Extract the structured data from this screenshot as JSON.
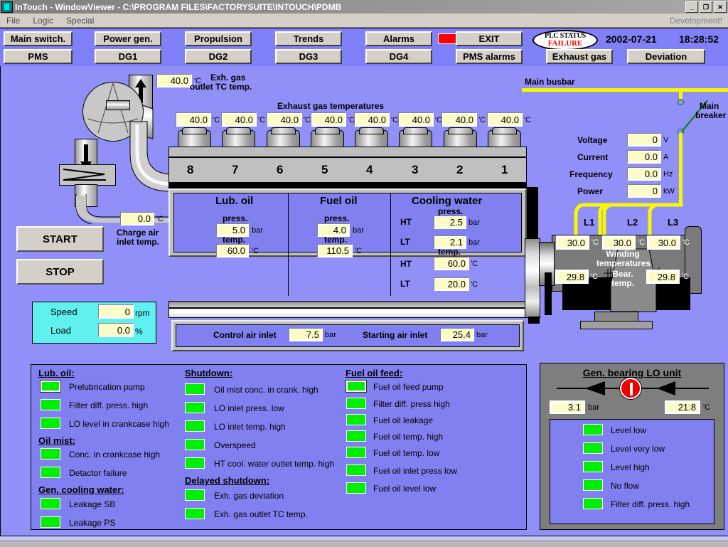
{
  "window": {
    "title": "InTouch - WindowViewer - C:\\PROGRAM FILES\\FACTORYSUITE\\INTOUCH\\PDMB",
    "icon": "intouch-icon",
    "minimize": "_",
    "restore": "❐",
    "close": "✕",
    "development_note": "Development!"
  },
  "menu": {
    "items": [
      "File",
      "Logic",
      "Special"
    ]
  },
  "toolbar": {
    "row1": [
      {
        "label": "Main switch."
      },
      {
        "label": "Power gen."
      },
      {
        "label": "Propulsion"
      },
      {
        "label": "Trends"
      },
      {
        "label": "Alarms"
      },
      {
        "label": "EXIT"
      }
    ],
    "row2": [
      {
        "label": "PMS"
      },
      {
        "label": "DG1"
      },
      {
        "label": "DG2"
      },
      {
        "label": "DG3"
      },
      {
        "label": "DG4"
      },
      {
        "label": "PMS alarms"
      },
      {
        "label": "Exhaust gas"
      },
      {
        "label": "Deviation"
      }
    ],
    "alarm_lamp_color": "#ff0000",
    "plc_status": {
      "line1": "PLC STATUS",
      "line2": "FAILURE",
      "color": "#ff0000"
    },
    "date": "2002-07-21",
    "time": "18:28:52"
  },
  "engine": {
    "tc_outlet": {
      "value": "40.0",
      "unit": "'C",
      "label_line1": "Exh. gas",
      "label_line2": "outlet TC temp."
    },
    "exhaust_title": "Exhaust gas temperatures",
    "exhaust_unit": "'C",
    "cylinders": [
      {
        "number": "8",
        "temp": "40.0"
      },
      {
        "number": "7",
        "temp": "40.0"
      },
      {
        "number": "6",
        "temp": "40.0"
      },
      {
        "number": "5",
        "temp": "40.0"
      },
      {
        "number": "4",
        "temp": "40.0"
      },
      {
        "number": "3",
        "temp": "40.0"
      },
      {
        "number": "2",
        "temp": "40.0"
      },
      {
        "number": "1",
        "temp": "40.0"
      }
    ],
    "charge_air": {
      "value": "0.0",
      "unit": "'C",
      "label_line1": "Charge air",
      "label_line2": "inlet temp."
    }
  },
  "controls": {
    "start": "START",
    "stop": "STOP",
    "speed_label": "Speed",
    "speed_value": "0",
    "speed_unit": "rpm",
    "load_label": "Load",
    "load_value": "0.0",
    "load_unit": "%"
  },
  "media": {
    "lub_oil": {
      "title": "Lub. oil",
      "press_label": "press.",
      "press_value": "5.0",
      "press_unit": "bar",
      "temp_label": "temp.",
      "temp_value": "60.0",
      "temp_unit": "'C"
    },
    "fuel_oil": {
      "title": "Fuel oil",
      "press_label": "press.",
      "press_value": "4.0",
      "press_unit": "bar",
      "temp_label": "temp.",
      "temp_value": "110.5",
      "temp_unit": "'C"
    },
    "cooling_water": {
      "title": "Cooling water",
      "press_label": "press.",
      "press_ht_label": "HT",
      "press_ht_value": "2.5",
      "press_ht_unit": "bar",
      "press_lt_label": "LT",
      "press_lt_value": "2.1",
      "press_lt_unit": "bar",
      "temp_label": "temp.",
      "temp_ht_label": "HT",
      "temp_ht_value": "60.0",
      "temp_ht_unit": "'C",
      "temp_lt_label": "LT",
      "temp_lt_value": "20.0",
      "temp_lt_unit": "'C"
    },
    "air": {
      "control_label": "Control air inlet",
      "control_value": "7.5",
      "control_unit": "bar",
      "starting_label": "Starting air inlet",
      "starting_value": "25.4",
      "starting_unit": "bar"
    }
  },
  "electrical": {
    "busbar_label": "Main busbar",
    "breaker_label_line1": "Main",
    "breaker_label_line2": "breaker",
    "measurements": [
      {
        "label": "Voltage",
        "value": "0",
        "unit": "V"
      },
      {
        "label": "Current",
        "value": "0.0",
        "unit": "A"
      },
      {
        "label": "Frequency",
        "value": "0.0",
        "unit": "Hz"
      },
      {
        "label": "Power",
        "value": "0",
        "unit": "kW"
      }
    ],
    "phases": [
      "L1",
      "L2",
      "L3"
    ],
    "winding_label_line1": "Winding",
    "winding_label_line2": "temperatures",
    "winding_temps": [
      "30.0",
      "30.0",
      "30.0"
    ],
    "winding_unit": "'C",
    "bearing_label_line1": "Bear.",
    "bearing_label_line2": "temp.",
    "bearing_temps": [
      "29.8",
      "29.8"
    ],
    "bearing_unit": "'C"
  },
  "alarms": {
    "col1": {
      "groups": [
        {
          "header": "Lub. oil:",
          "items": [
            {
              "label": "Prelubrication pump",
              "color": "#00ee00",
              "framed": true
            },
            {
              "label": "Filter diff. press. high",
              "color": "#00ee00",
              "framed": false
            },
            {
              "label": "LO level in crankcase high",
              "color": "#00ee00",
              "framed": false
            }
          ]
        },
        {
          "header": "Oil mist:",
          "items": [
            {
              "label": "Conc. in crankcase high",
              "color": "#00ee00",
              "framed": false
            },
            {
              "label": "Detactor failure",
              "color": "#00ee00",
              "framed": false
            }
          ]
        },
        {
          "header": "Gen. cooling water:",
          "items": [
            {
              "label": "Leakage SB",
              "color": "#00ee00",
              "framed": false
            },
            {
              "label": "Leakage PS",
              "color": "#00ee00",
              "framed": false
            }
          ]
        }
      ]
    },
    "col2": {
      "groups": [
        {
          "header": "Shutdown:",
          "items": [
            {
              "label": "Oil mist conc. in crank. high",
              "color": "#00ee00",
              "framed": false
            },
            {
              "label": "LO inlet press. low",
              "color": "#00ee00",
              "framed": false
            },
            {
              "label": "LO inlet temp. high",
              "color": "#00ee00",
              "framed": false
            },
            {
              "label": "Overspeed",
              "color": "#00ee00",
              "framed": false
            },
            {
              "label": "HT cool. water outlet temp. high",
              "color": "#00ee00",
              "framed": false
            }
          ]
        },
        {
          "header": "Delayed shutdown:",
          "items": [
            {
              "label": "Exh. gas deviation",
              "color": "#00ee00",
              "framed": false
            },
            {
              "label": "Exh. gas outlet TC temp.",
              "color": "#00ee00",
              "framed": false
            }
          ]
        }
      ]
    },
    "col3": {
      "groups": [
        {
          "header": "Fuel oil feed:",
          "items": [
            {
              "label": "Fuel oil feed pump",
              "color": "#00ee00",
              "framed": true
            },
            {
              "label": "Filter diff. press high",
              "color": "#00ee00",
              "framed": false
            },
            {
              "label": "Fuel oil leakage",
              "color": "#00ee00",
              "framed": false
            },
            {
              "label": "Fuel oil temp. high",
              "color": "#00ee00",
              "framed": false
            },
            {
              "label": "Fuel oil temp. low",
              "color": "#00ee00",
              "framed": false
            },
            {
              "label": "Fuel oil inlet press low",
              "color": "#00ee00",
              "framed": false
            },
            {
              "label": "Fuel oil level low",
              "color": "#00ee00",
              "framed": false
            }
          ]
        }
      ]
    }
  },
  "lo_unit": {
    "title": "Gen. bearing LO unit",
    "pressure": "3.1",
    "pressure_unit": "bar",
    "temperature": "21.8",
    "temperature_unit": "'C",
    "pump_icon": "pump-running-icon",
    "indicators": [
      {
        "label": "Level low",
        "color": "#00ee00"
      },
      {
        "label": "Level very low",
        "color": "#00ee00"
      },
      {
        "label": "Level high",
        "color": "#00ee00"
      },
      {
        "label": "No flow",
        "color": "#00ee00"
      },
      {
        "label": "Filter diff. press. high",
        "color": "#00ee00"
      }
    ]
  }
}
